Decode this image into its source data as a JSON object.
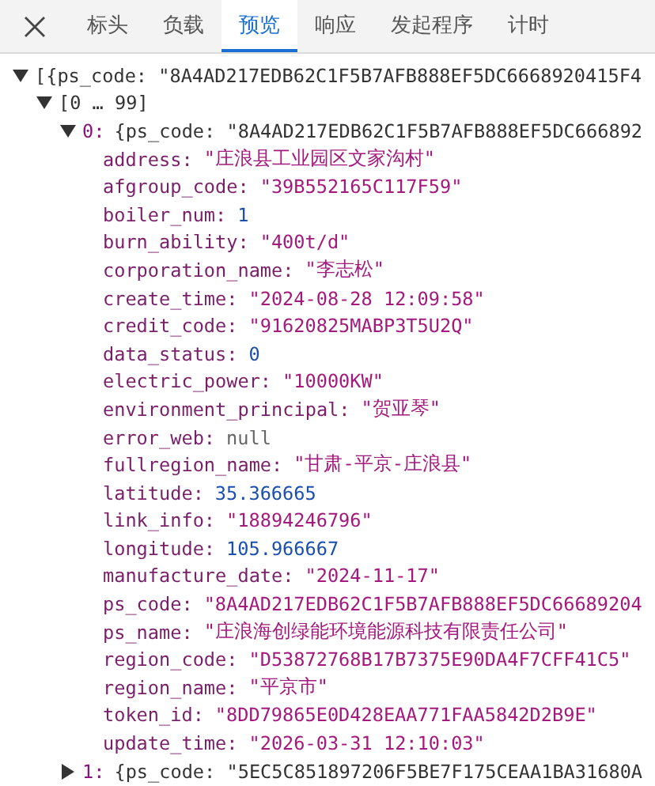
{
  "tabs": [
    {
      "label": "标头",
      "selected": false
    },
    {
      "label": "负载",
      "selected": false
    },
    {
      "label": "预览",
      "selected": true
    },
    {
      "label": "响应",
      "selected": false
    },
    {
      "label": "发起程序",
      "selected": false
    },
    {
      "label": "计时",
      "selected": false
    }
  ],
  "tree": [
    {
      "summary": "[{ps_code: \"8A4AD217EDB62C1F5B7AFB888EF5DC6668920415F4",
      "expanded": true,
      "children": [
        {
          "summary": "[0 … 99]",
          "expanded": true,
          "children": [
            {
              "index": "0:",
              "summary": "{ps_code: \"8A4AD217EDB62C1F5B7AFB888EF5DC666892",
              "expanded": true,
              "fields": [
                {
                  "key": "address:",
                  "value": "\"庄浪县工业园区文家沟村\"",
                  "kind": "string"
                },
                {
                  "key": "afgroup_code:",
                  "value": "\"39B552165C117F59\"",
                  "kind": "string"
                },
                {
                  "key": "boiler_num:",
                  "value": "1",
                  "kind": "number"
                },
                {
                  "key": "burn_ability:",
                  "value": "\"400t/d\"",
                  "kind": "string"
                },
                {
                  "key": "corporation_name:",
                  "value": "\"李志松\"",
                  "kind": "string"
                },
                {
                  "key": "create_time:",
                  "value": "\"2024-08-28 12:09:58\"",
                  "kind": "string"
                },
                {
                  "key": "credit_code:",
                  "value": "\"91620825MABP3T5U2Q\"",
                  "kind": "string"
                },
                {
                  "key": "data_status:",
                  "value": "0",
                  "kind": "number"
                },
                {
                  "key": "electric_power:",
                  "value": "\"10000KW\"",
                  "kind": "string"
                },
                {
                  "key": "environment_principal:",
                  "value": "\"贺亚琴\"",
                  "kind": "string"
                },
                {
                  "key": "error_web:",
                  "value": "null",
                  "kind": "null"
                },
                {
                  "key": "fullregion_name:",
                  "value": "\"甘肃-平京-庄浪县\"",
                  "kind": "string"
                },
                {
                  "key": "latitude:",
                  "value": "35.366665",
                  "kind": "number"
                },
                {
                  "key": "link_info:",
                  "value": "\"18894246796\"",
                  "kind": "string"
                },
                {
                  "key": "longitude:",
                  "value": "105.966667",
                  "kind": "number"
                },
                {
                  "key": "manufacture_date:",
                  "value": "\"2024-11-17\"",
                  "kind": "string"
                },
                {
                  "key": "ps_code:",
                  "value": "\"8A4AD217EDB62C1F5B7AFB888EF5DC66689204",
                  "kind": "string"
                },
                {
                  "key": "ps_name:",
                  "value": "\"庄浪海创绿能环境能源科技有限责任公司\"",
                  "kind": "string"
                },
                {
                  "key": "region_code:",
                  "value": "\"D53872768B17B7375E90DA4F7CFF41C5\"",
                  "kind": "string"
                },
                {
                  "key": "region_name:",
                  "value": "\"平京市\"",
                  "kind": "string"
                },
                {
                  "key": "token_id:",
                  "value": "\"8DD79865E0D428EAA771FAA5842D2B9E\"",
                  "kind": "string"
                },
                {
                  "key": "update_time:",
                  "value": "\"2026-03-31 12:10:03\"",
                  "kind": "string"
                }
              ]
            },
            {
              "index": "1:",
              "summary": "{ps_code: \"5EC5C851897206F5BE7F175CEAA1BA31680A",
              "expanded": false
            }
          ]
        }
      ]
    }
  ]
}
